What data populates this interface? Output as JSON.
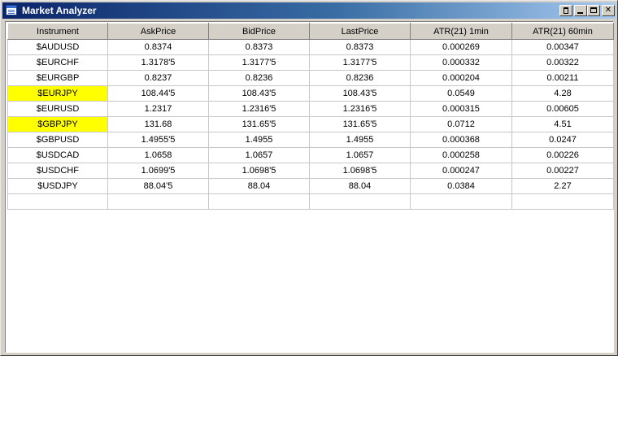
{
  "window": {
    "title": "Market Analyzer"
  },
  "colors": {
    "highlight": "#ffff00",
    "titlebar_start": "#0a246a",
    "titlebar_end": "#a6caf0"
  },
  "icons": {
    "app": "table-window-icon",
    "link": "link-icon",
    "minimize": "minimize-icon",
    "maximize": "maximize-icon",
    "close": "close-icon"
  },
  "table": {
    "headers": [
      "Instrument",
      "AskPrice",
      "BidPrice",
      "LastPrice",
      "ATR(21) 1min",
      "ATR(21) 60min"
    ],
    "rows": [
      {
        "instrument": "$AUDUSD",
        "ask": "0.8374",
        "bid": "0.8373",
        "last": "0.8373",
        "atr1": "0.000269",
        "atr60": "0.00347",
        "highlighted": false
      },
      {
        "instrument": "$EURCHF",
        "ask": "1.3178'5",
        "bid": "1.3177'5",
        "last": "1.3177'5",
        "atr1": "0.000332",
        "atr60": "0.00322",
        "highlighted": false
      },
      {
        "instrument": "$EURGBP",
        "ask": "0.8237",
        "bid": "0.8236",
        "last": "0.8236",
        "atr1": "0.000204",
        "atr60": "0.00211",
        "highlighted": false
      },
      {
        "instrument": "$EURJPY",
        "ask": "108.44'5",
        "bid": "108.43'5",
        "last": "108.43'5",
        "atr1": "0.0549",
        "atr60": "4.28",
        "highlighted": true
      },
      {
        "instrument": "$EURUSD",
        "ask": "1.2317",
        "bid": "1.2316'5",
        "last": "1.2316'5",
        "atr1": "0.000315",
        "atr60": "0.00605",
        "highlighted": false
      },
      {
        "instrument": "$GBPJPY",
        "ask": "131.68",
        "bid": "131.65'5",
        "last": "131.65'5",
        "atr1": "0.0712",
        "atr60": "4.51",
        "highlighted": true
      },
      {
        "instrument": "$GBPUSD",
        "ask": "1.4955'5",
        "bid": "1.4955",
        "last": "1.4955",
        "atr1": "0.000368",
        "atr60": "0.0247",
        "highlighted": false
      },
      {
        "instrument": "$USDCAD",
        "ask": "1.0658",
        "bid": "1.0657",
        "last": "1.0657",
        "atr1": "0.000258",
        "atr60": "0.00226",
        "highlighted": false
      },
      {
        "instrument": "$USDCHF",
        "ask": "1.0699'5",
        "bid": "1.0698'5",
        "last": "1.0698'5",
        "atr1": "0.000247",
        "atr60": "0.00227",
        "highlighted": false
      },
      {
        "instrument": "$USDJPY",
        "ask": "88.04'5",
        "bid": "88.04",
        "last": "88.04",
        "atr1": "0.0384",
        "atr60": "2.27",
        "highlighted": false
      },
      {
        "instrument": "",
        "ask": "",
        "bid": "",
        "last": "",
        "atr1": "",
        "atr60": "",
        "highlighted": false
      }
    ]
  }
}
